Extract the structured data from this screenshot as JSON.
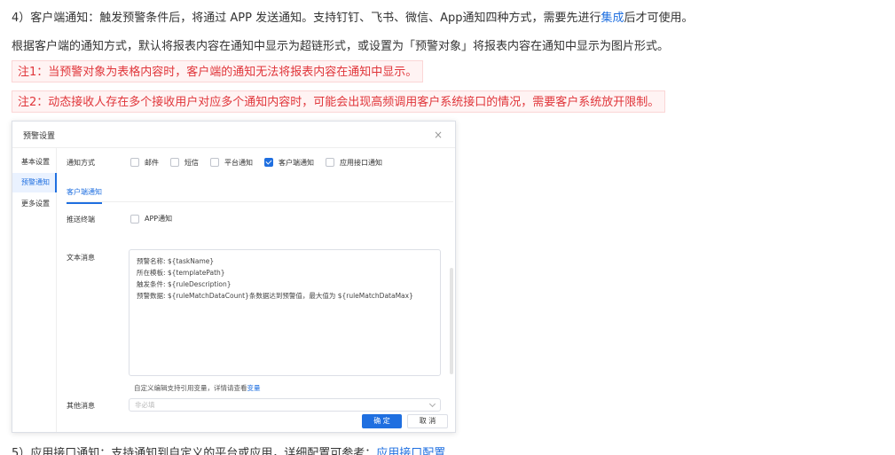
{
  "doc": {
    "line1_prefix": "4）客户端通知：触发预警条件后，将通过 APP 发送通知。支持钉钉、飞书、微信、App通知四种方式，需要先进行",
    "line1_link": "集成",
    "line1_suffix": "后才可使用。",
    "line2": "根据客户端的通知方式，默认将报表内容在通知中显示为超链形式，或设置为「预警对象」将报表内容在通知中显示为图片形式。",
    "note1": "注1：当预警对象为表格内容时，客户端的通知无法将报表内容在通知中显示。",
    "note2": "注2：动态接收人存在多个接收用户对应多个通知内容时，可能会出现高频调用客户系统接口的情况，需要客户系统放开限制。",
    "line5_prefix": "5）应用接口通知：支持通知到自定义的平台或应用，详细配置可参考：",
    "line5_link": "应用接口配置"
  },
  "modal": {
    "title": "预警设置",
    "close": "×",
    "nav": [
      {
        "label": "基本设置"
      },
      {
        "label": "预警通知"
      },
      {
        "label": "更多设置"
      }
    ],
    "notify_label": "通知方式",
    "methods": [
      {
        "label": "邮件",
        "checked": false
      },
      {
        "label": "短信",
        "checked": false
      },
      {
        "label": "平台通知",
        "checked": false
      },
      {
        "label": "客户端通知",
        "checked": true
      },
      {
        "label": "应用接口通知",
        "checked": false
      }
    ],
    "subtab": "客户端通知",
    "push_label": "推送终端",
    "push_option": "APP通知",
    "text_label": "文本消息",
    "text_lines": [
      "预警名称: ${taskName}",
      "所在模板: ${templatePath}",
      "触发条件: ${ruleDescription}",
      "预警数据: ${ruleMatchDataCount}条数据达到预警值，最大值为 ${ruleMatchDataMax}"
    ],
    "hint_prefix": "自定义编辑支持引用变量，详情请查看",
    "hint_link": "变量",
    "other_label": "其他消息",
    "other_placeholder": "非必填",
    "ok": "确 定",
    "cancel": "取 消"
  },
  "colors": {
    "accent": "#1f6fe0",
    "note_text": "#e0353a",
    "note_bg": "#fff3f3"
  }
}
